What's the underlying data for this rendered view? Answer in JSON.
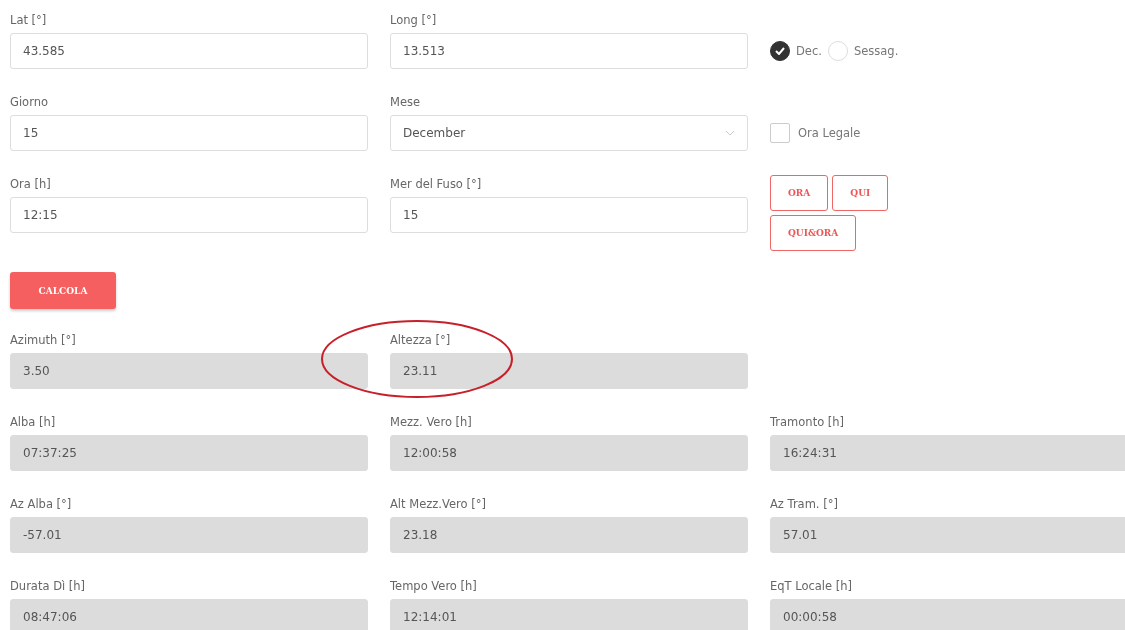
{
  "input_rows": [
    {
      "fields": [
        {
          "kind": "input",
          "label": "Lat [°]",
          "value": "43.585"
        },
        {
          "kind": "input",
          "label": "Long [°]",
          "value": "13.513"
        }
      ],
      "side": {
        "kind": "radios",
        "options": [
          {
            "label": "Dec.",
            "selected": true
          },
          {
            "label": "Sessag.",
            "selected": false
          }
        ]
      }
    },
    {
      "fields": [
        {
          "kind": "input",
          "label": "Giorno",
          "value": "15"
        },
        {
          "kind": "select",
          "label": "Mese",
          "value": "December"
        }
      ],
      "side": {
        "kind": "checkbox",
        "label": "Ora Legale",
        "checked": false
      }
    },
    {
      "fields": [
        {
          "kind": "input",
          "label": "Ora [h]",
          "value": "12:15"
        },
        {
          "kind": "input",
          "label": "Mer del Fuso [°]",
          "value": "15"
        }
      ],
      "side": {
        "kind": "buttons",
        "buttons": [
          "ORA",
          "QUI",
          "QUI&ORA"
        ]
      }
    }
  ],
  "calculate_button": "CALCOLA",
  "result_rows": [
    [
      {
        "label": "Azimuth [°]",
        "value": "3.50"
      },
      {
        "label": "Altezza [°]",
        "value": "23.11"
      }
    ],
    [
      {
        "label": "Alba [h]",
        "value": "07:37:25"
      },
      {
        "label": "Mezz. Vero [h]",
        "value": "12:00:58"
      },
      {
        "label": "Tramonto [h]",
        "value": "16:24:31"
      }
    ],
    [
      {
        "label": "Az Alba [°]",
        "value": "-57.01"
      },
      {
        "label": "Alt Mezz.Vero [°]",
        "value": "23.18"
      },
      {
        "label": "Az Tram. [°]",
        "value": "57.01"
      }
    ],
    [
      {
        "label": "Durata Dì [h]",
        "value": "08:47:06"
      },
      {
        "label": "Tempo Vero [h]",
        "value": "12:14:01"
      },
      {
        "label": "EqT Locale [h]",
        "value": "00:00:58"
      }
    ]
  ]
}
